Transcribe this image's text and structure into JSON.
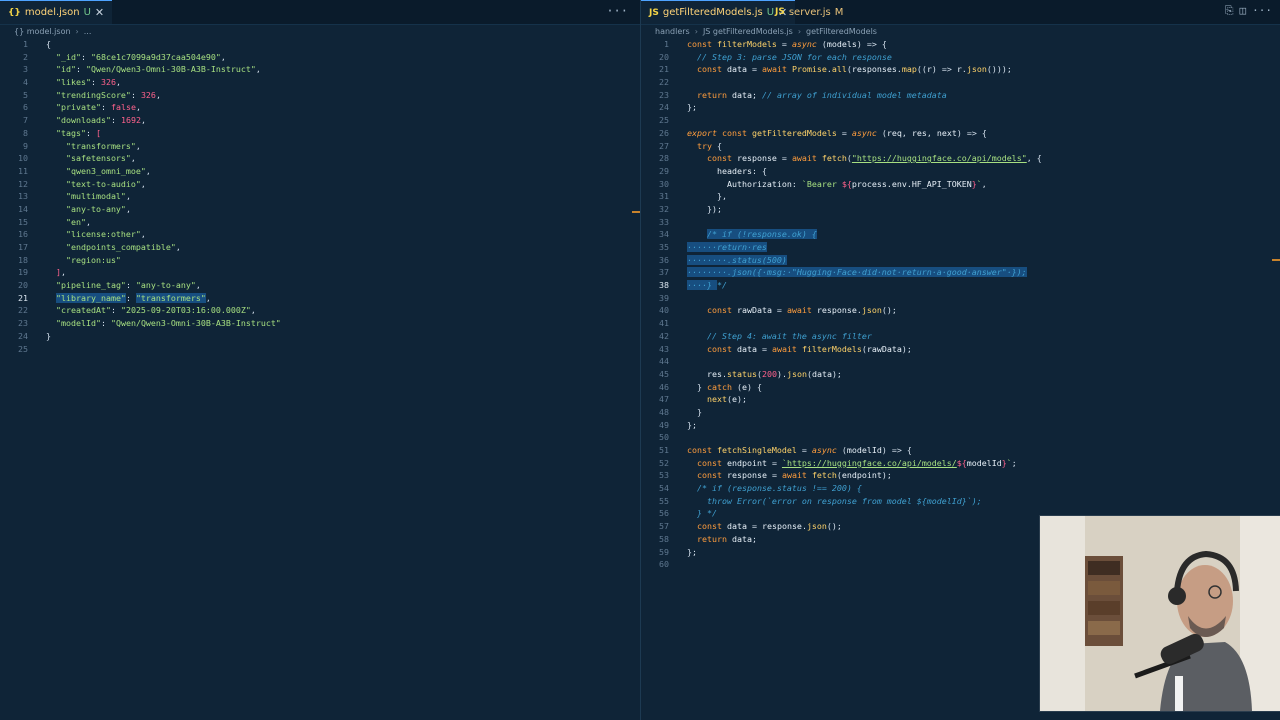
{
  "left": {
    "tab": {
      "file": "model.json",
      "badge": "U",
      "icon": "{}"
    },
    "breadcrumb": [
      "{} model.json",
      "..."
    ],
    "lines": [
      [
        [
          "p",
          "{"
        ]
      ],
      [
        [
          "p",
          "  "
        ],
        [
          "key",
          "\"_id\""
        ],
        [
          "p",
          ": "
        ],
        [
          "s",
          "\"68ce1c7099a9d37caa504e90\""
        ],
        [
          "p",
          ","
        ]
      ],
      [
        [
          "p",
          "  "
        ],
        [
          "key",
          "\"id\""
        ],
        [
          "p",
          ": "
        ],
        [
          "s",
          "\"Qwen/Qwen3-Omni-30B-A3B-Instruct\""
        ],
        [
          "p",
          ","
        ]
      ],
      [
        [
          "p",
          "  "
        ],
        [
          "key",
          "\"likes\""
        ],
        [
          "p",
          ": "
        ],
        [
          "n",
          "326"
        ],
        [
          "p",
          ","
        ]
      ],
      [
        [
          "p",
          "  "
        ],
        [
          "key",
          "\"trendingScore\""
        ],
        [
          "p",
          ": "
        ],
        [
          "n",
          "326"
        ],
        [
          "p",
          ","
        ]
      ],
      [
        [
          "p",
          "  "
        ],
        [
          "key",
          "\"private\""
        ],
        [
          "p",
          ": "
        ],
        [
          "n",
          "false"
        ],
        [
          "p",
          ","
        ]
      ],
      [
        [
          "p",
          "  "
        ],
        [
          "key",
          "\"downloads\""
        ],
        [
          "p",
          ": "
        ],
        [
          "n",
          "1692"
        ],
        [
          "p",
          ","
        ]
      ],
      [
        [
          "p",
          "  "
        ],
        [
          "key",
          "\"tags\""
        ],
        [
          "p",
          ": "
        ],
        [
          "n",
          "["
        ]
      ],
      [
        [
          "p",
          "    "
        ],
        [
          "s",
          "\"transformers\""
        ],
        [
          "p",
          ","
        ]
      ],
      [
        [
          "p",
          "    "
        ],
        [
          "s",
          "\"safetensors\""
        ],
        [
          "p",
          ","
        ]
      ],
      [
        [
          "p",
          "    "
        ],
        [
          "s",
          "\"qwen3_omni_moe\""
        ],
        [
          "p",
          ","
        ]
      ],
      [
        [
          "p",
          "    "
        ],
        [
          "s",
          "\"text-to-audio\""
        ],
        [
          "p",
          ","
        ]
      ],
      [
        [
          "p",
          "    "
        ],
        [
          "s",
          "\"multimodal\""
        ],
        [
          "p",
          ","
        ]
      ],
      [
        [
          "p",
          "    "
        ],
        [
          "s",
          "\"any-to-any\""
        ],
        [
          "p",
          ","
        ]
      ],
      [
        [
          "p",
          "    "
        ],
        [
          "s",
          "\"en\""
        ],
        [
          "p",
          ","
        ]
      ],
      [
        [
          "p",
          "    "
        ],
        [
          "s",
          "\"license:other\""
        ],
        [
          "p",
          ","
        ]
      ],
      [
        [
          "p",
          "    "
        ],
        [
          "s",
          "\"endpoints_compatible\""
        ],
        [
          "p",
          ","
        ]
      ],
      [
        [
          "p",
          "    "
        ],
        [
          "s",
          "\"region:us\""
        ]
      ],
      [
        [
          "p",
          "  "
        ],
        [
          "n",
          "]"
        ],
        [
          "p",
          ","
        ]
      ],
      [
        [
          "p",
          "  "
        ],
        [
          "key",
          "\"pipeline_tag\""
        ],
        [
          "p",
          ": "
        ],
        [
          "s",
          "\"any-to-any\""
        ],
        [
          "p",
          ","
        ]
      ],
      [
        [
          "p",
          "  "
        ],
        [
          "key",
          "\"library_name\""
        ],
        [
          "p",
          ": "
        ],
        [
          "s",
          "\"transformers\""
        ],
        [
          "p",
          ","
        ]
      ],
      [
        [
          "p",
          "  "
        ],
        [
          "key",
          "\"createdAt\""
        ],
        [
          "p",
          ": "
        ],
        [
          "s",
          "\"2025-09-20T03:16:00.000Z\""
        ],
        [
          "p",
          ","
        ]
      ],
      [
        [
          "p",
          "  "
        ],
        [
          "key",
          "\"modelId\""
        ],
        [
          "p",
          ": "
        ],
        [
          "s",
          "\"Qwen/Qwen3-Omni-30B-A3B-Instruct\""
        ]
      ],
      [
        [
          "p",
          "}"
        ]
      ],
      []
    ],
    "start_line": 1,
    "selected_line": 21
  },
  "right": {
    "tabs": [
      {
        "file": "getFilteredModels.js",
        "badge": "U",
        "icon": "JS"
      },
      {
        "file": "server.js",
        "badge": "M",
        "icon": "JS"
      }
    ],
    "breadcrumb": [
      "handlers",
      "JS getFilteredModels.js",
      "getFilteredModels"
    ],
    "line_numbers": [
      1,
      20,
      21,
      22,
      23,
      24,
      25,
      26,
      27,
      28,
      29,
      30,
      31,
      32,
      33,
      34,
      35,
      36,
      37,
      38,
      39,
      40,
      41,
      42,
      43,
      44,
      45,
      46,
      47,
      48,
      49,
      50,
      51,
      52,
      53,
      54,
      55,
      56,
      57,
      58,
      59,
      60
    ],
    "current_line": 38,
    "lines": [
      [
        [
          "k",
          "const "
        ],
        [
          "f",
          "filterModels"
        ],
        [
          "p",
          " = "
        ],
        [
          "kn",
          "async"
        ],
        [
          "p",
          " ("
        ],
        [
          "v",
          "models"
        ],
        [
          "p",
          ") => {"
        ]
      ],
      [
        [
          "p",
          "  "
        ],
        [
          "c",
          "// Step 3: parse JSON for each response"
        ]
      ],
      [
        [
          "p",
          "  "
        ],
        [
          "k",
          "const "
        ],
        [
          "v",
          "data"
        ],
        [
          "p",
          " = "
        ],
        [
          "k",
          "await "
        ],
        [
          "f",
          "Promise"
        ],
        [
          "p",
          "."
        ],
        [
          "f",
          "all"
        ],
        [
          "p",
          "("
        ],
        [
          "v",
          "responses"
        ],
        [
          "p",
          "."
        ],
        [
          "f",
          "map"
        ],
        [
          "p",
          "(("
        ],
        [
          "v",
          "r"
        ],
        [
          "p",
          ") => "
        ],
        [
          "v",
          "r"
        ],
        [
          "p",
          "."
        ],
        [
          "f",
          "json"
        ],
        [
          "p",
          "()));"
        ]
      ],
      [],
      [
        [
          "p",
          "  "
        ],
        [
          "k",
          "return "
        ],
        [
          "v",
          "data"
        ],
        [
          "p",
          "; "
        ],
        [
          "c",
          "// array of individual model metadata"
        ]
      ],
      [
        [
          "p",
          "};"
        ]
      ],
      [],
      [
        [
          "kn",
          "export "
        ],
        [
          "k",
          "const "
        ],
        [
          "f",
          "getFilteredModels"
        ],
        [
          "p",
          " = "
        ],
        [
          "kn",
          "async"
        ],
        [
          "p",
          " ("
        ],
        [
          "v",
          "req"
        ],
        [
          "p",
          ", "
        ],
        [
          "v",
          "res"
        ],
        [
          "p",
          ", "
        ],
        [
          "v",
          "next"
        ],
        [
          "p",
          ") => {"
        ]
      ],
      [
        [
          "p",
          "  "
        ],
        [
          "k",
          "try "
        ],
        [
          "p",
          "{"
        ]
      ],
      [
        [
          "p",
          "    "
        ],
        [
          "k",
          "const "
        ],
        [
          "v",
          "response"
        ],
        [
          "p",
          " = "
        ],
        [
          "k",
          "await "
        ],
        [
          "f",
          "fetch"
        ],
        [
          "p",
          "("
        ],
        [
          "url",
          "\"https://huggingface.co/api/models\""
        ],
        [
          "p",
          ", {"
        ]
      ],
      [
        [
          "p",
          "      "
        ],
        [
          "v",
          "headers"
        ],
        [
          "p",
          ": {"
        ]
      ],
      [
        [
          "p",
          "        "
        ],
        [
          "v",
          "Authorization"
        ],
        [
          "p",
          ": "
        ],
        [
          "s",
          "`Bearer "
        ],
        [
          "n",
          "${"
        ],
        [
          "v",
          "process.env.HF_API_TOKEN"
        ],
        [
          "n",
          "}"
        ],
        [
          "s",
          "`"
        ],
        [
          "p",
          ","
        ]
      ],
      [
        [
          "p",
          "      },"
        ]
      ],
      [
        [
          "p",
          "    });"
        ]
      ],
      [],
      [
        [
          "p",
          "    "
        ],
        [
          "sel:c",
          "/* if (!response.ok) {"
        ]
      ],
      [
        [
          "sel:c",
          "······return·res"
        ]
      ],
      [
        [
          "sel:c",
          "········.status(500)"
        ]
      ],
      [
        [
          "sel:c",
          "········.json({·msg:·\"Hugging·Face·did·not·return·a·good·answer\"·});"
        ]
      ],
      [
        [
          "sel:c",
          "····} "
        ],
        [
          "c",
          "*/"
        ]
      ],
      [],
      [
        [
          "p",
          "    "
        ],
        [
          "k",
          "const "
        ],
        [
          "v",
          "rawData"
        ],
        [
          "p",
          " = "
        ],
        [
          "k",
          "await "
        ],
        [
          "v",
          "response"
        ],
        [
          "p",
          "."
        ],
        [
          "f",
          "json"
        ],
        [
          "p",
          "();"
        ]
      ],
      [],
      [
        [
          "p",
          "    "
        ],
        [
          "c",
          "// Step 4: await the async filter"
        ]
      ],
      [
        [
          "p",
          "    "
        ],
        [
          "k",
          "const "
        ],
        [
          "v",
          "data"
        ],
        [
          "p",
          " = "
        ],
        [
          "k",
          "await "
        ],
        [
          "f",
          "filterModels"
        ],
        [
          "p",
          "("
        ],
        [
          "v",
          "rawData"
        ],
        [
          "p",
          ");"
        ]
      ],
      [],
      [
        [
          "p",
          "    "
        ],
        [
          "v",
          "res"
        ],
        [
          "p",
          "."
        ],
        [
          "f",
          "status"
        ],
        [
          "p",
          "("
        ],
        [
          "n",
          "200"
        ],
        [
          "p",
          ")."
        ],
        [
          "f",
          "json"
        ],
        [
          "p",
          "("
        ],
        [
          "v",
          "data"
        ],
        [
          "p",
          ");"
        ]
      ],
      [
        [
          "p",
          "  } "
        ],
        [
          "k",
          "catch "
        ],
        [
          "p",
          "("
        ],
        [
          "v",
          "e"
        ],
        [
          "p",
          ") {"
        ]
      ],
      [
        [
          "p",
          "    "
        ],
        [
          "f",
          "next"
        ],
        [
          "p",
          "("
        ],
        [
          "v",
          "e"
        ],
        [
          "p",
          ");"
        ]
      ],
      [
        [
          "p",
          "  }"
        ]
      ],
      [
        [
          "p",
          "};"
        ]
      ],
      [],
      [
        [
          "k",
          "const "
        ],
        [
          "f",
          "fetchSingleModel"
        ],
        [
          "p",
          " = "
        ],
        [
          "kn",
          "async"
        ],
        [
          "p",
          " ("
        ],
        [
          "v",
          "modelId"
        ],
        [
          "p",
          ") => {"
        ]
      ],
      [
        [
          "p",
          "  "
        ],
        [
          "k",
          "const "
        ],
        [
          "v",
          "endpoint"
        ],
        [
          "p",
          " = "
        ],
        [
          "url",
          "`https://huggingface.co/api/models/"
        ],
        [
          "n",
          "${"
        ],
        [
          "v",
          "modelId"
        ],
        [
          "n",
          "}"
        ],
        [
          "s",
          "`"
        ],
        [
          "p",
          ";"
        ]
      ],
      [
        [
          "p",
          "  "
        ],
        [
          "k",
          "const "
        ],
        [
          "v",
          "response"
        ],
        [
          "p",
          " = "
        ],
        [
          "k",
          "await "
        ],
        [
          "f",
          "fetch"
        ],
        [
          "p",
          "("
        ],
        [
          "v",
          "endpoint"
        ],
        [
          "p",
          ");"
        ]
      ],
      [
        [
          "p",
          "  "
        ],
        [
          "c",
          "/* if (response.status !== 200) {"
        ]
      ],
      [
        [
          "p",
          "    "
        ],
        [
          "c",
          "throw Error(`error on response from model ${modelId}`);"
        ]
      ],
      [
        [
          "p",
          "  "
        ],
        [
          "c",
          "} */"
        ]
      ],
      [
        [
          "p",
          "  "
        ],
        [
          "k",
          "const "
        ],
        [
          "v",
          "data"
        ],
        [
          "p",
          " = "
        ],
        [
          "v",
          "response"
        ],
        [
          "p",
          "."
        ],
        [
          "f",
          "json"
        ],
        [
          "p",
          "();"
        ]
      ],
      [
        [
          "p",
          "  "
        ],
        [
          "k",
          "return "
        ],
        [
          "v",
          "data"
        ],
        [
          "p",
          ";"
        ]
      ],
      [
        [
          "p",
          "};"
        ]
      ],
      []
    ]
  }
}
